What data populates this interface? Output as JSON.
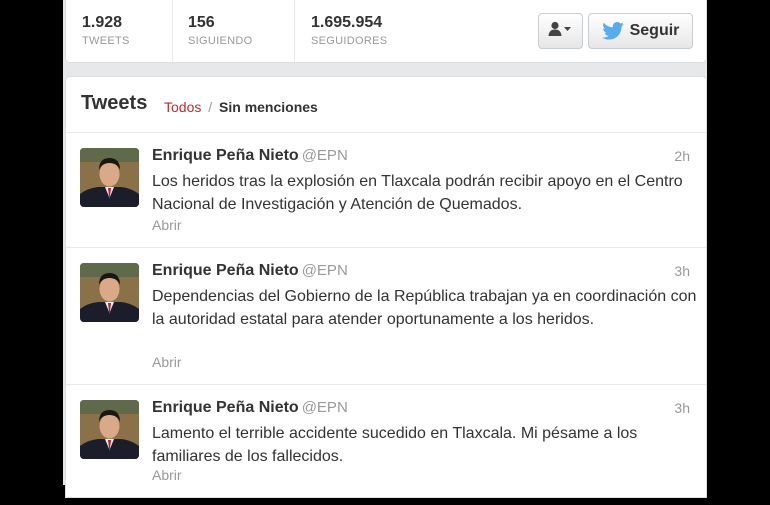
{
  "profile_stats": {
    "tweets": {
      "value": "1.928",
      "label": "TWEETS"
    },
    "following": {
      "value": "156",
      "label": "SIGUIENDO"
    },
    "followers": {
      "value": "1.695.954",
      "label": "SEGUIDORES"
    }
  },
  "actions": {
    "user_menu_icon": "user-dropdown-icon",
    "follow_label": "Seguir",
    "follow_icon": "twitter-bird-icon",
    "brand_color": "#55acee"
  },
  "timeline": {
    "title": "Tweets",
    "filter_all": "Todos",
    "filter_separator": "/",
    "filter_no_mentions": "Sin menciones",
    "accent_color": "#c22a2a"
  },
  "tweets": [
    {
      "name": "Enrique Peña Nieto",
      "handle": "@EPN",
      "time": "2h",
      "text": "Los heridos tras la explosión en Tlaxcala podrán recibir apoyo en el Centro Nacional de Investigación y Atención de Quemados.",
      "open_label": "Abrir"
    },
    {
      "name": "Enrique Peña Nieto",
      "handle": "@EPN",
      "time": "3h",
      "text": "Dependencias del Gobierno de la República trabajan ya en coordinación con la autoridad estatal para atender oportunamente a los heridos.",
      "open_label": "Abrir"
    },
    {
      "name": "Enrique Peña Nieto",
      "handle": "@EPN",
      "time": "3h",
      "text": "Lamento el terrible accidente sucedido en Tlaxcala. Mi pésame a los familiares de los fallecidos.",
      "open_label": "Abrir"
    }
  ]
}
